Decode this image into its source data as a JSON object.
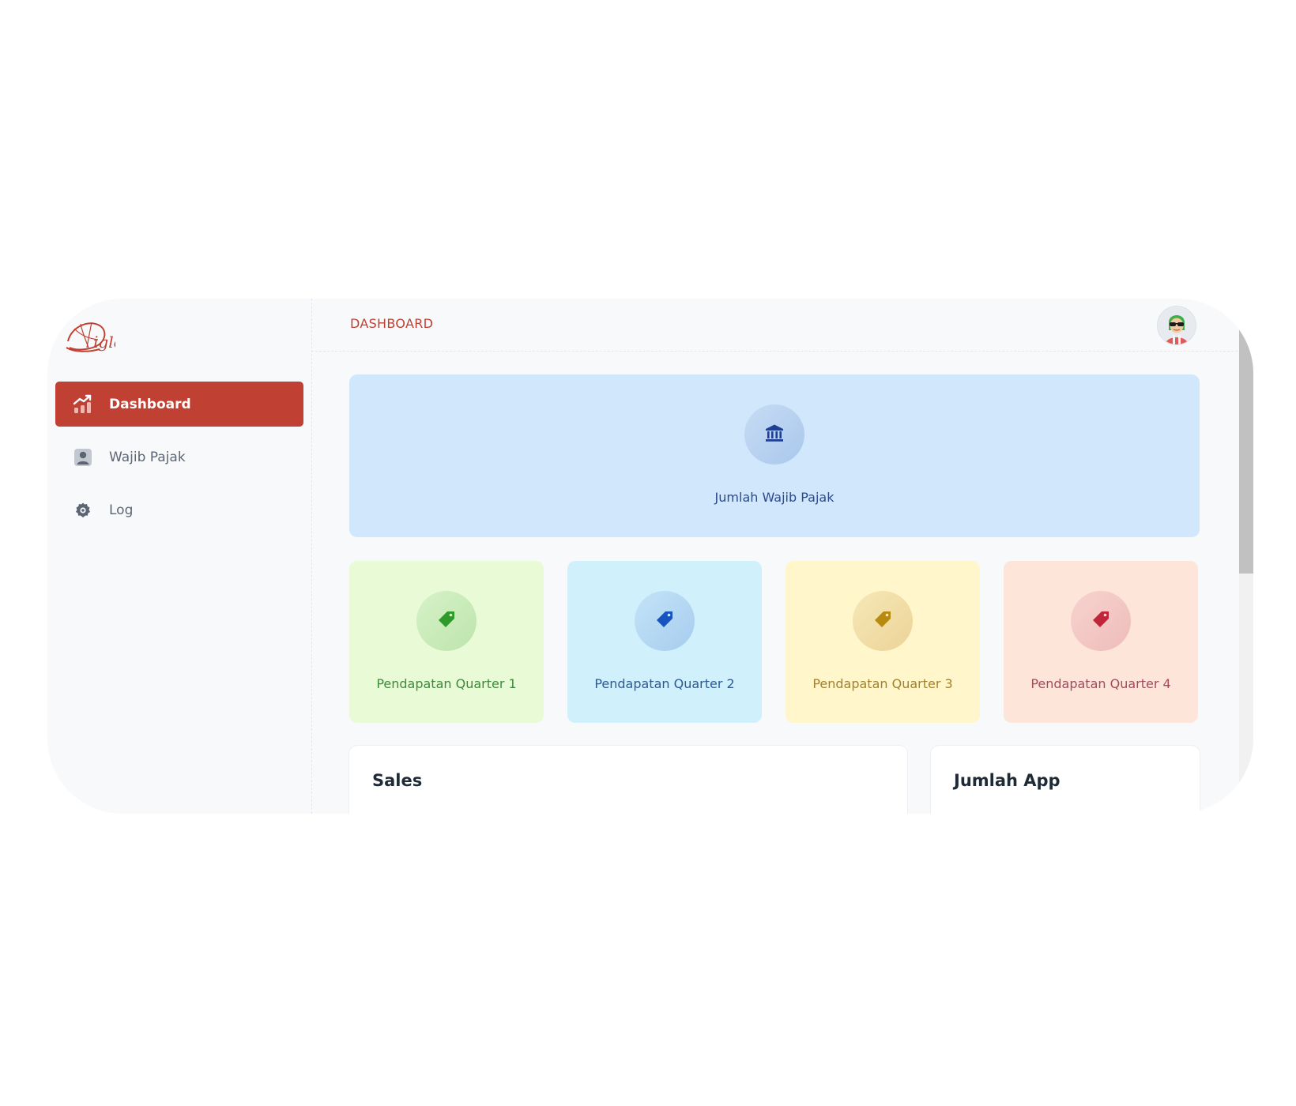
{
  "app": {
    "brand_color": "#c04133",
    "logo_text": "iglo"
  },
  "sidebar": {
    "items": [
      {
        "label": "Dashboard",
        "icon": "chart-growth-icon",
        "active": true
      },
      {
        "label": "Wajib Pajak",
        "icon": "user-card-icon",
        "active": false
      },
      {
        "label": "Log",
        "icon": "gear-icon",
        "active": false
      }
    ]
  },
  "header": {
    "title": "DASHBOARD",
    "avatar": "user-avatar"
  },
  "stats": {
    "hero": {
      "label": "Jumlah Wajib Pajak",
      "icon": "bank-icon",
      "color": "#1e3f94"
    },
    "quarters": [
      {
        "label": "Pendapatan Quarter 1",
        "icon": "tag-icon",
        "color": "#2e9a2a"
      },
      {
        "label": "Pendapatan Quarter 2",
        "icon": "tag-icon",
        "color": "#1854bd"
      },
      {
        "label": "Pendapatan Quarter 3",
        "icon": "tag-icon",
        "color": "#b88a10"
      },
      {
        "label": "Pendapatan Quarter 4",
        "icon": "tag-icon",
        "color": "#c0253a"
      }
    ]
  },
  "panels": {
    "sales": {
      "title": "Sales"
    },
    "jumlah_app": {
      "title": "Jumlah App"
    }
  }
}
